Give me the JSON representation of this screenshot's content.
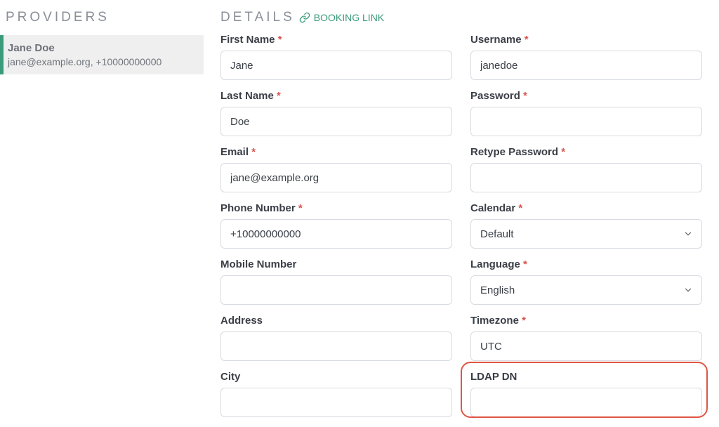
{
  "sidebar": {
    "title": "PROVIDERS",
    "item": {
      "name": "Jane Doe",
      "meta": "jane@example.org, +10000000000"
    }
  },
  "header": {
    "title": "DETAILS",
    "booking_label": "BOOKING LINK"
  },
  "labels": {
    "first_name": "First Name",
    "last_name": "Last Name",
    "email": "Email",
    "phone": "Phone Number",
    "mobile": "Mobile Number",
    "address": "Address",
    "city": "City",
    "username": "Username",
    "password": "Password",
    "retype_password": "Retype Password",
    "calendar": "Calendar",
    "language": "Language",
    "timezone": "Timezone",
    "ldap_dn": "LDAP DN"
  },
  "values": {
    "first_name": "Jane",
    "last_name": "Doe",
    "email": "jane@example.org",
    "phone": "+10000000000",
    "mobile": "",
    "address": "",
    "city": "",
    "username": "janedoe",
    "password": "",
    "retype_password": "",
    "calendar": "Default",
    "language": "English",
    "timezone": "UTC",
    "ldap_dn": ""
  },
  "req_marker": "*"
}
